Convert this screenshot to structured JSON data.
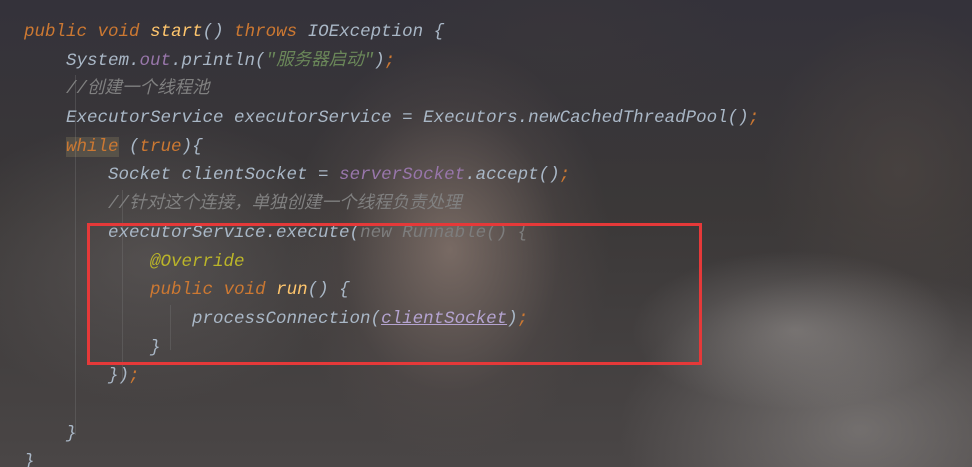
{
  "editor": {
    "lines": [
      {
        "indent": "",
        "tokens": [
          {
            "t": "public",
            "c": "kw"
          },
          {
            "t": " "
          },
          {
            "t": "void",
            "c": "kw"
          },
          {
            "t": " "
          },
          {
            "t": "start",
            "c": "fn"
          },
          {
            "t": "() "
          },
          {
            "t": "throws",
            "c": "kw"
          },
          {
            "t": " IOException {"
          }
        ]
      },
      {
        "indent": "    ",
        "tokens": [
          {
            "t": "System."
          },
          {
            "t": "out",
            "c": "fld"
          },
          {
            "t": ".println("
          },
          {
            "t": "\"服务器启动\"",
            "c": "str"
          },
          {
            "t": ")"
          },
          {
            "t": ";",
            "c": "semi"
          }
        ]
      },
      {
        "indent": "    ",
        "tokens": [
          {
            "t": "//创建一个线程池",
            "c": "cm"
          }
        ]
      },
      {
        "indent": "    ",
        "tokens": [
          {
            "t": "ExecutorService executorService = Executors.newCachedThreadPool()"
          },
          {
            "t": ";",
            "c": "semi"
          }
        ]
      },
      {
        "indent": "    ",
        "tokens": [
          {
            "t": "while",
            "c": "kw hl"
          },
          {
            "t": " ("
          },
          {
            "t": "true",
            "c": "kw"
          },
          {
            "t": "){"
          }
        ]
      },
      {
        "indent": "        ",
        "tokens": [
          {
            "t": "Socket clientSocket = "
          },
          {
            "t": "serverSocket",
            "c": "fld"
          },
          {
            "t": ".accept()"
          },
          {
            "t": ";",
            "c": "semi"
          }
        ]
      },
      {
        "indent": "        ",
        "tokens": [
          {
            "t": "//针对这个连接，单独创建一个线程负责处理",
            "c": "cm"
          }
        ]
      },
      {
        "indent": "        ",
        "tokens": [
          {
            "t": "executorService.execute("
          },
          {
            "t": "new Runnable() {",
            "c": "dim"
          }
        ]
      },
      {
        "indent": "            ",
        "tokens": [
          {
            "t": "@Override",
            "c": "ann"
          }
        ]
      },
      {
        "indent": "            ",
        "tokens": [
          {
            "t": "public",
            "c": "kw"
          },
          {
            "t": " "
          },
          {
            "t": "void",
            "c": "kw"
          },
          {
            "t": " "
          },
          {
            "t": "run",
            "c": "fn"
          },
          {
            "t": "() {"
          }
        ]
      },
      {
        "indent": "                ",
        "tokens": [
          {
            "t": "processConnection("
          },
          {
            "t": "clientSocket",
            "c": "ul"
          },
          {
            "t": ")"
          },
          {
            "t": ";",
            "c": "semi"
          }
        ]
      },
      {
        "indent": "            ",
        "tokens": [
          {
            "t": "}"
          }
        ]
      },
      {
        "indent": "        ",
        "tokens": [
          {
            "t": "})"
          },
          {
            "t": ";",
            "c": "semi"
          }
        ]
      },
      {
        "indent": "",
        "tokens": []
      },
      {
        "indent": "    ",
        "tokens": [
          {
            "t": "}"
          }
        ]
      },
      {
        "indent": "",
        "tokens": [
          {
            "t": "}"
          }
        ]
      }
    ]
  },
  "highlight_box": {
    "color": "#e53939",
    "covers_lines": "executorService.execute block"
  },
  "colors": {
    "keyword": "#cc7832",
    "method": "#ffc66d",
    "field": "#9876aa",
    "string": "#6a8759",
    "comment": "#808080",
    "annotation": "#bbb529",
    "default": "#a9b7c6"
  }
}
